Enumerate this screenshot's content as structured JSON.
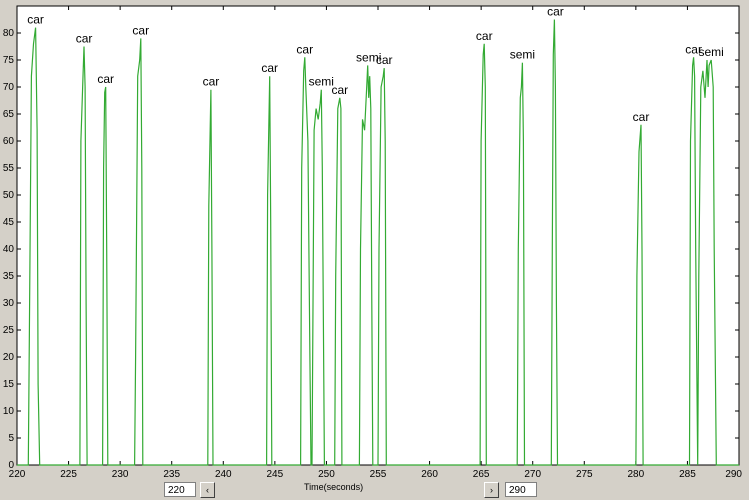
{
  "chart_data": {
    "type": "line",
    "xlabel": "Time(seconds)",
    "ylabel": "",
    "title": "",
    "xlim": [
      220,
      290
    ],
    "ylim": [
      0,
      85
    ],
    "xticks": [
      220,
      225,
      230,
      235,
      240,
      245,
      250,
      255,
      260,
      265,
      270,
      275,
      280,
      285,
      290
    ],
    "yticks": [
      0,
      5,
      10,
      15,
      20,
      25,
      30,
      35,
      40,
      45,
      50,
      55,
      60,
      65,
      70,
      75,
      80
    ],
    "grid": false,
    "line_color": "#33aa33",
    "peaks": [
      {
        "x": 221.8,
        "y": 81,
        "label": "car"
      },
      {
        "x": 226.5,
        "y": 77.5,
        "label": "car"
      },
      {
        "x": 228.6,
        "y": 70,
        "label": "car"
      },
      {
        "x": 232.0,
        "y": 79,
        "label": "car"
      },
      {
        "x": 238.8,
        "y": 69.5,
        "label": "car"
      },
      {
        "x": 244.5,
        "y": 72,
        "label": "car"
      },
      {
        "x": 247.9,
        "y": 75.5,
        "label": "car"
      },
      {
        "x": 249.5,
        "y": 69.5,
        "label": "semi"
      },
      {
        "x": 251.3,
        "y": 68,
        "label": "car"
      },
      {
        "x": 254.1,
        "y": 74,
        "label": "semi"
      },
      {
        "x": 255.6,
        "y": 73.5,
        "label": "car"
      },
      {
        "x": 265.3,
        "y": 78,
        "label": "car"
      },
      {
        "x": 269.0,
        "y": 74.5,
        "label": "semi"
      },
      {
        "x": 272.2,
        "y": 82.5,
        "label": "car"
      },
      {
        "x": 280.5,
        "y": 63,
        "label": "car"
      },
      {
        "x": 285.6,
        "y": 75.5,
        "label": "car"
      },
      {
        "x": 287.3,
        "y": 75,
        "label": "semi"
      }
    ],
    "series": [
      {
        "x": [
          220,
          221.1,
          221.2,
          221.4,
          221.6,
          221.8,
          221.95,
          222.05,
          222.2,
          226.1,
          226.2,
          226.4,
          226.5,
          226.6,
          226.7,
          226.8,
          228.3,
          228.4,
          228.5,
          228.6,
          228.7,
          228.8,
          231.4,
          231.5,
          231.7,
          231.9,
          232.0,
          232.1,
          232.2,
          238.5,
          238.6,
          238.8,
          238.9,
          239.0,
          244.2,
          244.3,
          244.5,
          244.6,
          244.7,
          247.5,
          247.6,
          247.8,
          247.9,
          248.0,
          248.2,
          248.4,
          248.5,
          248.6,
          248.8,
          249.0,
          249.2,
          249.4,
          249.5,
          249.6,
          249.8,
          250.8,
          250.9,
          251.1,
          251.3,
          251.4,
          251.5,
          253.2,
          253.3,
          253.5,
          253.7,
          253.9,
          254.0,
          254.1,
          254.2,
          254.3,
          254.4,
          254.5,
          255.0,
          255.1,
          255.3,
          255.5,
          255.6,
          255.7,
          255.8,
          264.9,
          265.0,
          265.2,
          265.3,
          265.4,
          265.5,
          268.5,
          268.6,
          268.8,
          268.9,
          269.0,
          269.1,
          269.2,
          271.8,
          271.9,
          272.0,
          272.1,
          272.2,
          272.3,
          272.4,
          280.0,
          280.1,
          280.3,
          280.5,
          280.6,
          280.7,
          285.2,
          285.3,
          285.5,
          285.6,
          285.7,
          285.8,
          286.0,
          286.1,
          286.3,
          286.5,
          286.7,
          286.9,
          287.0,
          287.1,
          287.3,
          287.5,
          287.6,
          287.8,
          290
        ],
        "y": [
          0,
          0,
          25,
          72,
          78,
          81,
          62,
          15,
          0,
          0,
          60,
          72,
          77.5,
          70,
          30,
          0,
          0,
          55,
          69,
          70,
          40,
          0,
          0,
          20,
          72,
          75,
          79,
          55,
          0,
          0,
          48,
          69.5,
          40,
          0,
          0,
          50,
          72,
          45,
          0,
          0,
          55,
          73,
          75.5,
          70,
          60,
          20,
          0,
          0,
          62,
          66,
          64,
          67,
          69.5,
          55,
          0,
          0,
          35,
          66,
          68,
          66,
          0,
          0,
          40,
          64,
          62,
          70,
          74,
          68,
          72,
          66,
          30,
          0,
          0,
          40,
          70,
          72,
          73.5,
          60,
          0,
          0,
          60,
          76,
          78,
          70,
          0,
          0,
          40,
          68,
          70,
          74.5,
          60,
          0,
          0,
          40,
          76,
          82.5,
          70,
          30,
          0,
          0,
          35,
          58,
          63,
          40,
          0,
          0,
          60,
          74,
          75.5,
          72,
          40,
          0,
          35,
          70,
          73,
          68,
          75,
          70,
          74,
          75,
          70,
          40,
          0,
          0
        ]
      }
    ]
  },
  "controls": {
    "left_value": "220",
    "right_value": "290",
    "left_arrow": "‹",
    "right_arrow": "›"
  }
}
